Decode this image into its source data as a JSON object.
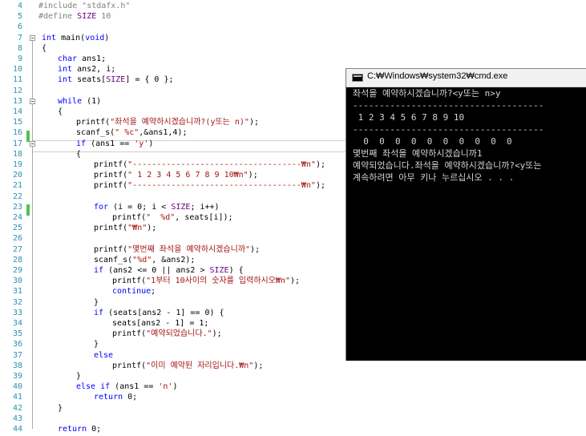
{
  "editor": {
    "line_numbers": [
      "4",
      "5",
      "6",
      "7",
      "8",
      "9",
      "10",
      "11",
      "12",
      "13",
      "14",
      "15",
      "16",
      "17",
      "18",
      "19",
      "20",
      "21",
      "22",
      "23",
      "24",
      "25",
      "26",
      "27",
      "28",
      "29",
      "30",
      "31",
      "32",
      "33",
      "34",
      "35",
      "36",
      "37",
      "38",
      "39",
      "40",
      "41",
      "42",
      "43",
      "44"
    ],
    "code": {
      "l4": [
        "#include \"stdafx.h\""
      ],
      "l5": [
        "#define ",
        "SIZE",
        " 10"
      ],
      "l7": [
        "int",
        " main(",
        "void",
        ")"
      ],
      "l8": [
        "{"
      ],
      "l9": [
        "char",
        " ans1;"
      ],
      "l10": [
        "int",
        " ans2, i;"
      ],
      "l11": [
        "int",
        " seats[",
        "SIZE",
        "] = { 0 };"
      ],
      "l13": [
        "while",
        " (1)"
      ],
      "l14": [
        "{"
      ],
      "l15": [
        "printf(",
        "\"좌석을 예약하시겠습니까?(y또는 n)\"",
        ");"
      ],
      "l16": [
        "scanf_s(",
        "\" %c\"",
        ",&ans1,4);"
      ],
      "l17": [
        "if",
        " (ans1 == ",
        "'y'",
        ")"
      ],
      "l18": [
        "{"
      ],
      "l19": [
        "printf(",
        "\"-----------------------------------₩n\"",
        ");"
      ],
      "l20": [
        "printf(",
        "\" 1 2 3 4 5 6 7 8 9 10₩n\"",
        ");"
      ],
      "l21": [
        "printf(",
        "\"-----------------------------------₩n\"",
        ");"
      ],
      "l23": [
        "for",
        " (i = 0; i < ",
        "SIZE",
        "; i++)"
      ],
      "l24": [
        "printf(",
        "\"  %d\"",
        ", seats[i]);"
      ],
      "l25": [
        "printf(",
        "\"₩n\"",
        ");"
      ],
      "l27": [
        "printf(",
        "\"몇번째 좌석을 예약하시겠습니까\"",
        ");"
      ],
      "l28": [
        "scanf_s(",
        "\"%d\"",
        ", &ans2);"
      ],
      "l29": [
        "if",
        " (ans2 <= 0 || ans2 > ",
        "SIZE",
        ") {"
      ],
      "l30": [
        "printf(",
        "\"1부터 10사이의 숫자를 입력하시오₩n\"",
        ");"
      ],
      "l31": [
        "continue",
        ";"
      ],
      "l32": [
        "}"
      ],
      "l33": [
        "if",
        " (seats[ans2 - 1] == 0) {"
      ],
      "l34": [
        "seats[ans2 - 1] = 1;"
      ],
      "l35": [
        "printf(",
        "\"예약되었습니다.\"",
        ");"
      ],
      "l36": [
        "}"
      ],
      "l37": [
        "else"
      ],
      "l38": [
        "printf(",
        "\"이미 예약된 자리입니다.₩n\"",
        ");"
      ],
      "l39": [
        "}"
      ],
      "l40": [
        "else if",
        " (ans1 == ",
        "'n'",
        ")"
      ],
      "l41": [
        "return",
        " 0;"
      ],
      "l42": [
        "}"
      ],
      "l44": [
        "return",
        " 0;"
      ]
    }
  },
  "console": {
    "title": "C:₩Windows₩system32₩cmd.exe",
    "lines": [
      "좌석을 예약하시겠습니까?<y또는 n>y",
      "------------------------------------",
      " 1 2 3 4 5 6 7 8 9 10",
      "------------------------------------",
      "  0  0  0  0  0  0  0  0  0  0",
      "몇번째 좌석을 예약하시겠습니까1",
      "예약되었습니다.좌석을 예약하시겠습니까?<y또는",
      "계속하려면 아무 키나 누르십시오 . . ."
    ]
  },
  "colors": {
    "keyword": "#0000ff",
    "string": "#a31515",
    "macro": "#6f008a",
    "line_number": "#2b91af",
    "change_marker": "#52c14a",
    "console_bg": "#000000",
    "console_fg": "#d4d4d4"
  }
}
